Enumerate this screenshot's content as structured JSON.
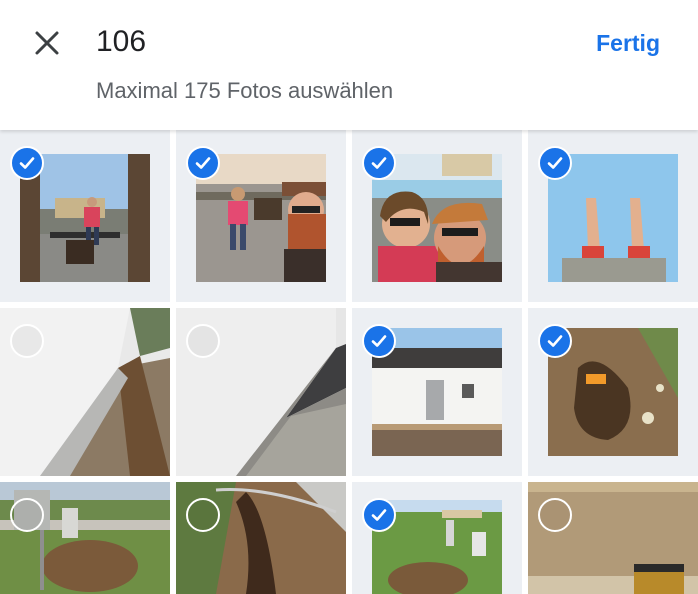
{
  "header": {
    "selected_count": "106",
    "done_label": "Fertig",
    "subtitle": "Maximal 175 Fotos auswählen",
    "close_icon": "close-icon"
  },
  "colors": {
    "accent": "#1a73e8",
    "tile_background": "#eceff3"
  },
  "photos": [
    {
      "row": 1,
      "col": 1,
      "selected": true,
      "subject": "person on terrace"
    },
    {
      "row": 1,
      "col": 2,
      "selected": true,
      "subject": "selfie with person on bench"
    },
    {
      "row": 1,
      "col": 3,
      "selected": true,
      "subject": "couple selfie"
    },
    {
      "row": 1,
      "col": 4,
      "selected": true,
      "subject": "feet on floor"
    },
    {
      "row": 2,
      "col": 1,
      "selected": false,
      "subject": "house wall with gravel"
    },
    {
      "row": 2,
      "col": 2,
      "selected": false,
      "subject": "house wall with gravel"
    },
    {
      "row": 2,
      "col": 3,
      "selected": true,
      "subject": "house facade"
    },
    {
      "row": 2,
      "col": 4,
      "selected": true,
      "subject": "dug hole in soil"
    },
    {
      "row": 3,
      "col": 1,
      "selected": false,
      "subject": "garden with excavation"
    },
    {
      "row": 3,
      "col": 2,
      "selected": false,
      "subject": "trench in soil"
    },
    {
      "row": 3,
      "col": 3,
      "selected": true,
      "subject": "lawn with soil mound"
    },
    {
      "row": 3,
      "col": 4,
      "selected": false,
      "subject": "sand field with can"
    }
  ]
}
